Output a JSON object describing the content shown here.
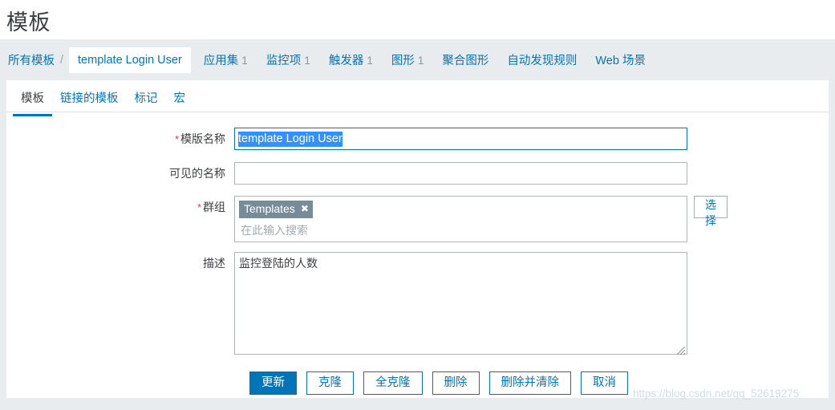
{
  "page": {
    "title": "模板"
  },
  "breadcrumb": {
    "all_templates": "所有模板",
    "separator": "/",
    "current": "template Login User"
  },
  "nav": {
    "items": [
      {
        "label": "应用集",
        "count": "1"
      },
      {
        "label": "监控项",
        "count": "1"
      },
      {
        "label": "触发器",
        "count": "1"
      },
      {
        "label": "图形",
        "count": "1"
      },
      {
        "label": "聚合图形",
        "count": ""
      },
      {
        "label": "自动发现规则",
        "count": ""
      },
      {
        "label": "Web 场景",
        "count": ""
      }
    ]
  },
  "tabs": [
    {
      "label": "模板",
      "active": true
    },
    {
      "label": "链接的模板",
      "active": false
    },
    {
      "label": "标记",
      "active": false
    },
    {
      "label": "宏",
      "active": false
    }
  ],
  "form": {
    "template_name": {
      "label": "模版名称",
      "required": "*",
      "value": "template Login User",
      "selected": true
    },
    "visible_name": {
      "label": "可见的名称",
      "required": "",
      "value": "",
      "placeholder": ""
    },
    "groups": {
      "label": "群组",
      "required": "*",
      "chips": [
        {
          "label": "Templates",
          "remove_icon": "✖"
        }
      ],
      "placeholder": "在此输入搜索",
      "select_button": "选择"
    },
    "description": {
      "label": "描述",
      "required": "",
      "value": "监控登陆的人数"
    }
  },
  "buttons": [
    {
      "label": "更新",
      "primary": true
    },
    {
      "label": "克隆",
      "primary": false
    },
    {
      "label": "全克隆",
      "primary": false
    },
    {
      "label": "删除",
      "primary": false
    },
    {
      "label": "删除并清除",
      "primary": false
    },
    {
      "label": "取消",
      "primary": false
    }
  ],
  "watermark": "https://blog.csdn.net/qq_52619275",
  "colors": {
    "accent": "#0275b8",
    "nav_bg": "#e8ecef",
    "chip_bg": "#768d99",
    "selection": "#3390ff",
    "required": "#d34343"
  }
}
